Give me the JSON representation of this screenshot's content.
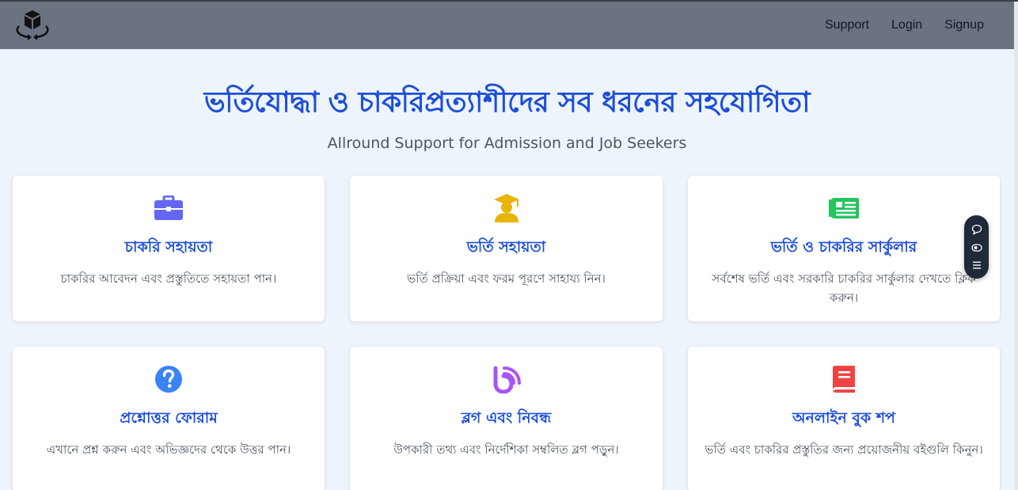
{
  "navbar": {
    "logo_icon": "cube-arrows-icon",
    "links": [
      "Support",
      "Login",
      "Signup"
    ]
  },
  "hero": {
    "title": "ভর্তিযোদ্ধা ও চাকরিপ্রত্যাশীদের সব ধরনের সহযোগিতা",
    "subtitle": "Allround Support for Admission and Job Seekers"
  },
  "cards": [
    {
      "icon": "briefcase-icon",
      "icon_color": "#6366f1",
      "title": "চাকরি সহায়তা",
      "description": "চাকরির আবেদন এবং প্রস্তুতিতে সহায়তা পান।"
    },
    {
      "icon": "graduate-icon",
      "icon_color": "#eab308",
      "title": "ভর্তি সহায়তা",
      "description": "ভর্তি প্রক্রিয়া এবং ফরম পূরণে সাহায্য নিন।"
    },
    {
      "icon": "newspaper-icon",
      "icon_color": "#22c55e",
      "title": "ভর্তি ও চাকরির সার্কুলার",
      "description": "সর্বশেষ ভর্তি এবং সরকারি চাকরির সার্কুলার দেখতে ক্লিক করুন।"
    },
    {
      "icon": "question-circle-icon",
      "icon_color": "#3b82f6",
      "title": "প্রশ্নোত্তর ফোরাম",
      "description": "এখানে প্রশ্ন করুন এবং অভিজ্ঞদের থেকে উত্তর পান।"
    },
    {
      "icon": "blog-icon",
      "icon_color": "#a855f7",
      "title": "ব্লগ এবং নিবন্ধ",
      "description": "উপকারী তথ্য এবং নির্দেশিকা সম্বলিত ব্লগ পড়ুন।"
    },
    {
      "icon": "book-icon",
      "icon_color": "#ef4444",
      "title": "অনলাইন বুক শপ",
      "description": "ভর্তি এবং চাকরির প্রস্তুতির জন্য প্রয়োজনীয় বইগুলি কিনুন।"
    }
  ],
  "floating_widget": {
    "icons": [
      "chat-bubble-icon",
      "eye-toggle-icon",
      "menu-icon"
    ]
  },
  "colors": {
    "navbar_bg": "#6b7280",
    "page_bg": "#eef4fb",
    "accent": "#1d4ed8"
  }
}
